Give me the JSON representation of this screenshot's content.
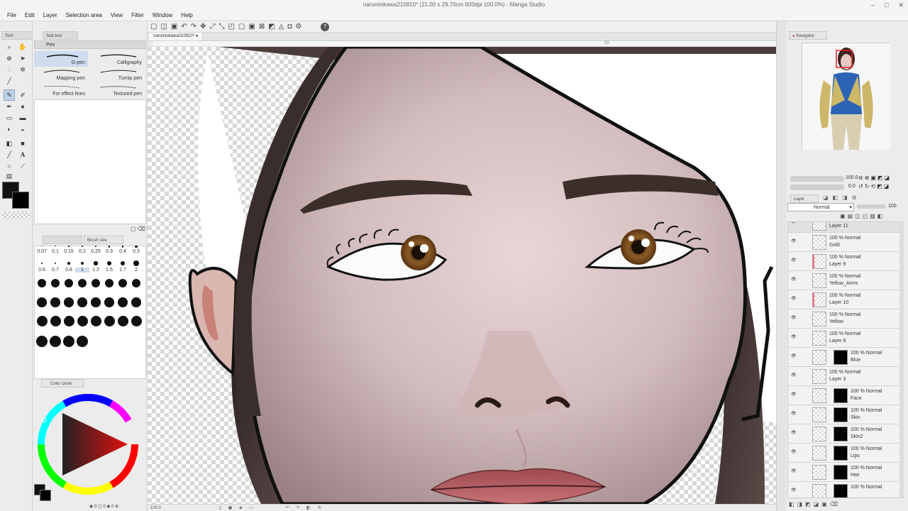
{
  "window": {
    "title": "narumiokawa210810* (21.00 x 29.70cm 600dpi 100.0%) - Manga Studio",
    "controls": [
      "–",
      "□",
      "✕"
    ]
  },
  "menu": [
    "File",
    "Edit",
    "Layer",
    "Selection area",
    "View",
    "Filter",
    "Window",
    "Help"
  ],
  "left_panel": {
    "tool_tab": "Tool",
    "subtool_tab": "Sub tool",
    "subtool_group": "Pen",
    "pens": [
      "G-pen",
      "Calligraphy",
      "Mapping pen",
      "Turnip pen",
      "For effect lines",
      "Textured pen"
    ],
    "brush_size_tab": "Brush size",
    "brush_sizes_row1": [
      "0.07",
      "0.1",
      "0.15",
      "0.2",
      "0.25",
      "0.3",
      "0.4",
      "0.5"
    ],
    "brush_sizes_row2": [
      "0.6",
      "0.7",
      "0.8",
      "1",
      "1.2",
      "1.5",
      "1.7",
      "2"
    ],
    "color_circle_tab": "Color circle",
    "main_color": "#111111",
    "sub_color": "#000000"
  },
  "document": {
    "tab_label": "narumiokawa210810*",
    "ruler_mark": "10",
    "zoom": "100.0"
  },
  "right_panel": {
    "navigator_tab": "Navigator",
    "zoom_value": "100.0",
    "rotation_value": "0.0",
    "layer_tab": "Layer",
    "blend_mode": "Normal",
    "opacity": "100",
    "layers": [
      {
        "name": "Layer 11",
        "props": ""
      },
      {
        "name": "Gold",
        "props": "100 %  Normal"
      },
      {
        "name": "Layer 9",
        "props": "100 %  Normal"
      },
      {
        "name": "Yellow_Arms",
        "props": "100 %  Normal"
      },
      {
        "name": "Layer 10",
        "props": "100 %  Normal"
      },
      {
        "name": "Yellow",
        "props": "100 %  Normal"
      },
      {
        "name": "Layer 8",
        "props": "100 %  Normal"
      },
      {
        "name": "Blue",
        "props": "100 %  Normal"
      },
      {
        "name": "Layer 3",
        "props": "100 %  Normal"
      },
      {
        "name": "Face",
        "props": "100 %  Normal"
      },
      {
        "name": "Skin",
        "props": "100 %  Normal"
      },
      {
        "name": "Skin2",
        "props": "100 %  Normal"
      },
      {
        "name": "Lips",
        "props": "100 %  Normal"
      },
      {
        "name": "Hair",
        "props": "100 %  Normal"
      },
      {
        "name": "",
        "props": "100 %  Normal"
      }
    ]
  }
}
